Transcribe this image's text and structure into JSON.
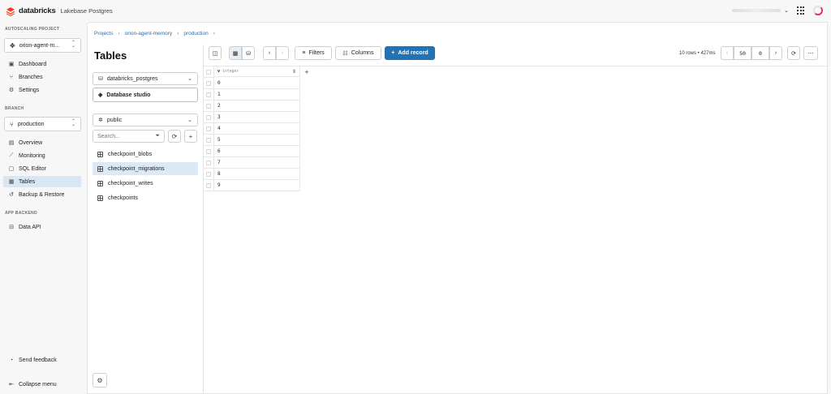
{
  "header": {
    "brand": "databricks",
    "product": "Lakebase Postgres"
  },
  "sidebar": {
    "project_label": "AUTOSCALING PROJECT",
    "project_value": "orion-agent-m...",
    "project_items": [
      {
        "label": "Dashboard",
        "icon": "dashboard-icon"
      },
      {
        "label": "Branches",
        "icon": "branches-icon"
      },
      {
        "label": "Settings",
        "icon": "gear-icon"
      }
    ],
    "branch_label": "BRANCH",
    "branch_value": "production",
    "branch_items": [
      {
        "label": "Overview",
        "icon": "overview-icon"
      },
      {
        "label": "Monitoring",
        "icon": "monitoring-icon"
      },
      {
        "label": "SQL Editor",
        "icon": "sql-icon"
      },
      {
        "label": "Tables",
        "icon": "table-icon",
        "active": true
      },
      {
        "label": "Backup & Restore",
        "icon": "backup-icon"
      }
    ],
    "backend_label": "APP BACKEND",
    "backend_items": [
      {
        "label": "Data API",
        "icon": "api-icon"
      }
    ],
    "feedback": "Send feedback",
    "collapse": "Collapse menu"
  },
  "main": {
    "breadcrumb": [
      "Projects",
      "orion-agent-memory",
      "production"
    ],
    "title": "Tables",
    "database": "databricks_postgres",
    "studio_button": "Database studio",
    "schema": "public",
    "search_placeholder": "Search...",
    "tables": [
      {
        "name": "checkpoint_blobs"
      },
      {
        "name": "checkpoint_migrations",
        "active": true
      },
      {
        "name": "checkpoint_writes"
      },
      {
        "name": "checkpoints"
      }
    ]
  },
  "toolbar": {
    "filters": "Filters",
    "columns": "Columns",
    "add_record": "Add record",
    "rows_info": "10 rows • 427ms",
    "limit": "50",
    "offset": "0"
  },
  "grid": {
    "column_name": "v",
    "column_type": "integer",
    "rows": [
      "0",
      "1",
      "2",
      "3",
      "4",
      "5",
      "6",
      "7",
      "8",
      "9"
    ]
  },
  "colors": {
    "accent": "#2272b4",
    "active_bg": "#dbe8f6"
  }
}
